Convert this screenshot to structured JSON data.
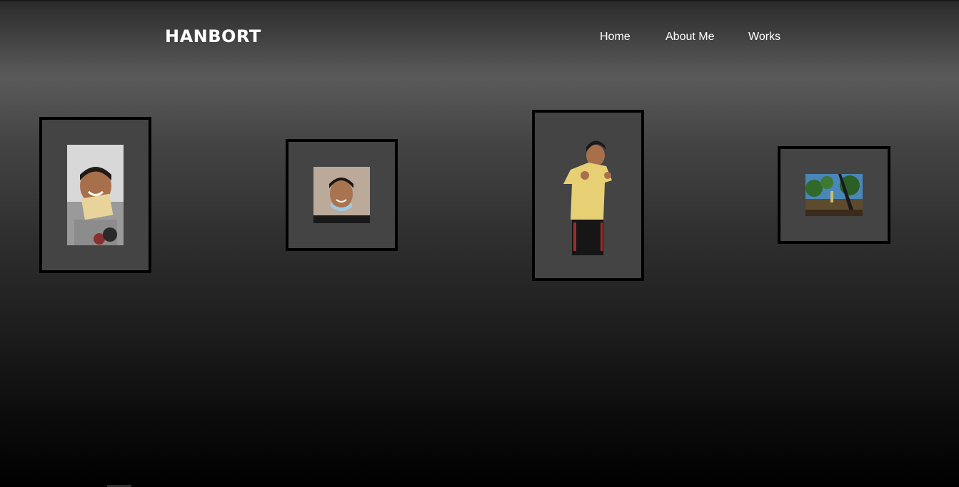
{
  "header": {
    "logo": "HANBORT",
    "nav": [
      {
        "label": "Home"
      },
      {
        "label": "About Me"
      },
      {
        "label": "Works"
      }
    ]
  },
  "gallery": {
    "frames": [
      {
        "photo": "photo-of-smiling-person-holding-certificate"
      },
      {
        "photo": "selfie-with-face-mask-on-chin"
      },
      {
        "photo": "person-in-yellow-shirt-thumbs-up"
      },
      {
        "photo": "game-landscape-screenshot"
      }
    ]
  },
  "colors": {
    "frame_border": "#000000",
    "frame_fill": "#444444",
    "text": "#ffffff"
  }
}
